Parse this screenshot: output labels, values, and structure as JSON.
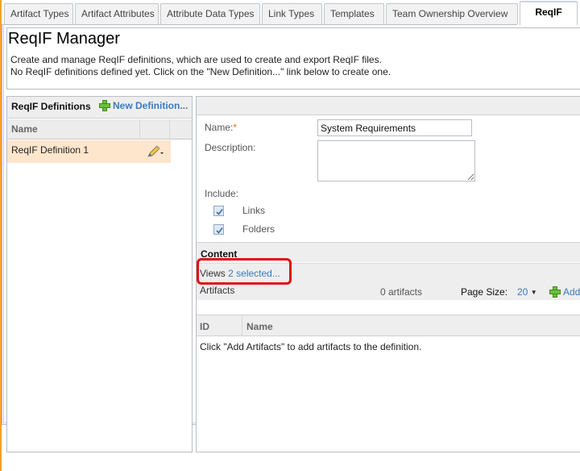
{
  "tabs": [
    {
      "label": "Artifact Types",
      "active": false
    },
    {
      "label": "Artifact Attributes",
      "active": false
    },
    {
      "label": "Attribute Data Types",
      "active": false
    },
    {
      "label": "Link Types",
      "active": false
    },
    {
      "label": "Templates",
      "active": false
    },
    {
      "label": "Team Ownership Overview",
      "active": false
    },
    {
      "label": "ReqIF",
      "active": true
    }
  ],
  "header": {
    "title": "ReqIF Manager",
    "description_line1": "Create and manage ReqIF definitions, which are used to create and export ReqIF files.",
    "description_line2": "No ReqIF definitions defined yet. Click on the \"New Definition...\" link below to create one."
  },
  "definitions_panel": {
    "title": "ReqIF Definitions",
    "new_definition_label": "New Definition...",
    "column_name": "Name",
    "rows": [
      {
        "name": "ReqIF Definition 1",
        "selected": true
      }
    ]
  },
  "form": {
    "name_label": "Name:",
    "required_marker": "*",
    "name_value": "System Requirements",
    "description_label": "Description:",
    "description_value": "",
    "include_label": "Include:",
    "include_options": [
      {
        "label": "Links",
        "checked": true
      },
      {
        "label": "Folders",
        "checked": true
      }
    ]
  },
  "content": {
    "title": "Content",
    "views_label": "Views",
    "views_link": "2 selected...",
    "artifacts_label": "Artifacts",
    "artifacts_count": "0 artifacts",
    "page_size_label": "Page Size:",
    "page_size_value": "20",
    "add_label": "Add",
    "table_columns": [
      "ID",
      "Name"
    ],
    "empty_message": "Click \"Add Artifacts\" to add artifacts to the definition."
  },
  "colors": {
    "accent_link": "#3a7bbf",
    "selected_row": "#fde6cc",
    "highlight": "#e01010",
    "required": "#e07020"
  }
}
